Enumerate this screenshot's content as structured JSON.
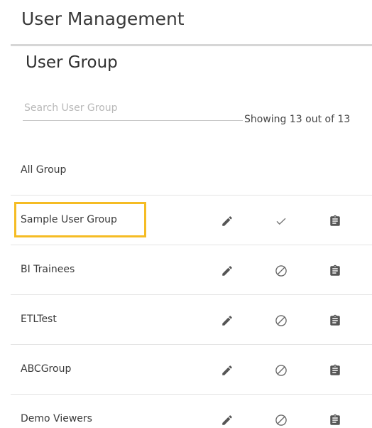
{
  "header": {
    "title": "User Management"
  },
  "section": {
    "title": "User Group"
  },
  "search": {
    "placeholder": "Search User Group",
    "value": ""
  },
  "summary": {
    "showing": "Showing 13 out of 13"
  },
  "groups": [
    {
      "label": "All Group",
      "actions": []
    },
    {
      "label": "Sample User Group",
      "highlighted": true,
      "actions": [
        "edit-icon",
        "check-icon",
        "clipboard-icon"
      ]
    },
    {
      "label": "BI Trainees",
      "actions": [
        "edit-icon",
        "block-icon",
        "clipboard-icon"
      ]
    },
    {
      "label": "ETLTest",
      "actions": [
        "edit-icon",
        "block-icon",
        "clipboard-icon"
      ]
    },
    {
      "label": "ABCGroup",
      "actions": [
        "edit-icon",
        "block-icon",
        "clipboard-icon"
      ]
    },
    {
      "label": "Demo Viewers",
      "actions": [
        "edit-icon",
        "block-icon",
        "clipboard-icon"
      ]
    }
  ],
  "colors": {
    "highlight": "#f5bc24",
    "icon": "#555555",
    "divider": "#e4e4e4"
  }
}
